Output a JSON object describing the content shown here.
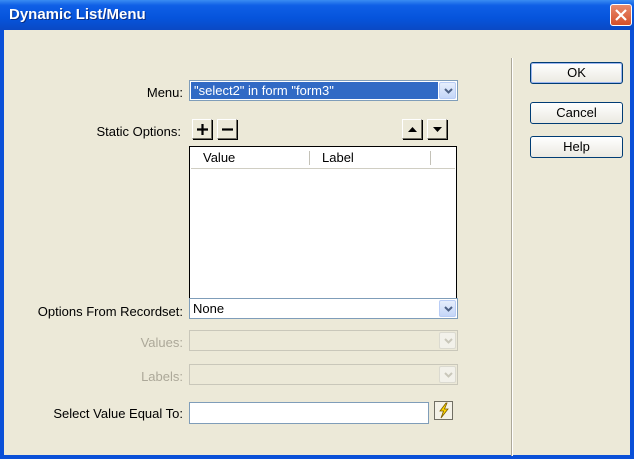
{
  "window": {
    "title": "Dynamic List/Menu"
  },
  "menu": {
    "label": "Menu:",
    "value": "\"select2\" in form \"form3\""
  },
  "static_options": {
    "label": "Static Options:",
    "columns": [
      "Value",
      "Label"
    ]
  },
  "recordset": {
    "label": "Options From Recordset:",
    "value": "None"
  },
  "values": {
    "label": "Values:",
    "value": ""
  },
  "labels": {
    "label": "Labels:",
    "value": ""
  },
  "select_value": {
    "label": "Select Value Equal To:",
    "value": ""
  },
  "buttons": {
    "ok": "OK",
    "cancel": "Cancel",
    "help": "Help"
  },
  "icons": {
    "close": "close-icon",
    "add": "plus-icon",
    "remove": "minus-icon",
    "up": "arrow-up-icon",
    "down": "arrow-down-icon",
    "dynamic_data": "lightning-icon"
  },
  "colors": {
    "titlebar": "#0654dc",
    "selection": "#316ac5",
    "face": "#ece9d8"
  }
}
